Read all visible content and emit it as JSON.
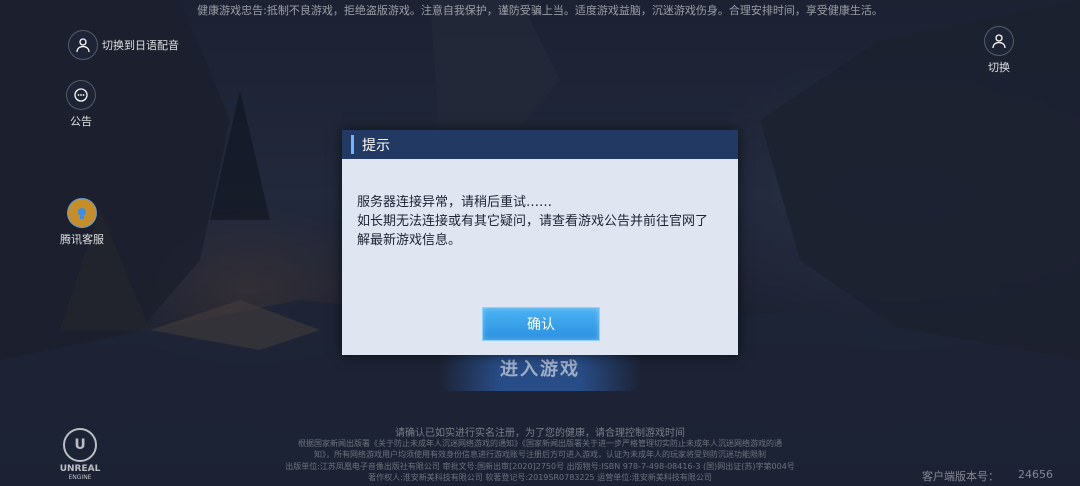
{
  "top_warning": "健康游戏忠告:抵制不良游戏，拒绝盗版游戏。注意自我保护，谨防受骗上当。适度游戏益脑，沉迷游戏伤身。合理安排时间，享受健康生活。",
  "left_menu": {
    "voice_switch": "切换到日语配音",
    "announcement": "公告",
    "customer_service": "腾讯客服"
  },
  "right_menu": {
    "switch_account": "切换"
  },
  "enter_game": "进入游戏",
  "realname_notice": "请确认已如实进行实名注册，为了您的健康，请合理控制游戏时间",
  "legal_lines": [
    "根据国家新闻出版署《关于防止未成年人沉迷网络游戏的通知》《国家新闻出版署关于进一步严格管理切实防止未成年人沉迷网络游戏的通",
    "知》，所有网络游戏用户均须使用有效身份信息进行游戏账号注册后方可进入游戏，认证为未成年人的玩家将受到防沉迷功能限制",
    "出版单位:江苏凤凰电子音像出版社有限公司  审批文号:国新出审[2020]2750号  出版物号:ISBN 978-7-498-08416-3  (国)网出证(苏)字第004号",
    "著作权人:淮安新美科技有限公司  软著登记号:2019SR0783225  运营单位:淮安新美科技有限公司"
  ],
  "engine_logo": {
    "mark": "U",
    "line1": "UNREAL",
    "line2": "ENGINE"
  },
  "version": {
    "label": "客户端版本号：",
    "value": "24656"
  },
  "dialog": {
    "title": "提示",
    "line1": "服务器连接异常，请稍后重试……",
    "line2": "如长期无法连接或有其它疑问，请查看游戏公告并前往官网了解最新游戏信息。",
    "confirm": "确认"
  }
}
